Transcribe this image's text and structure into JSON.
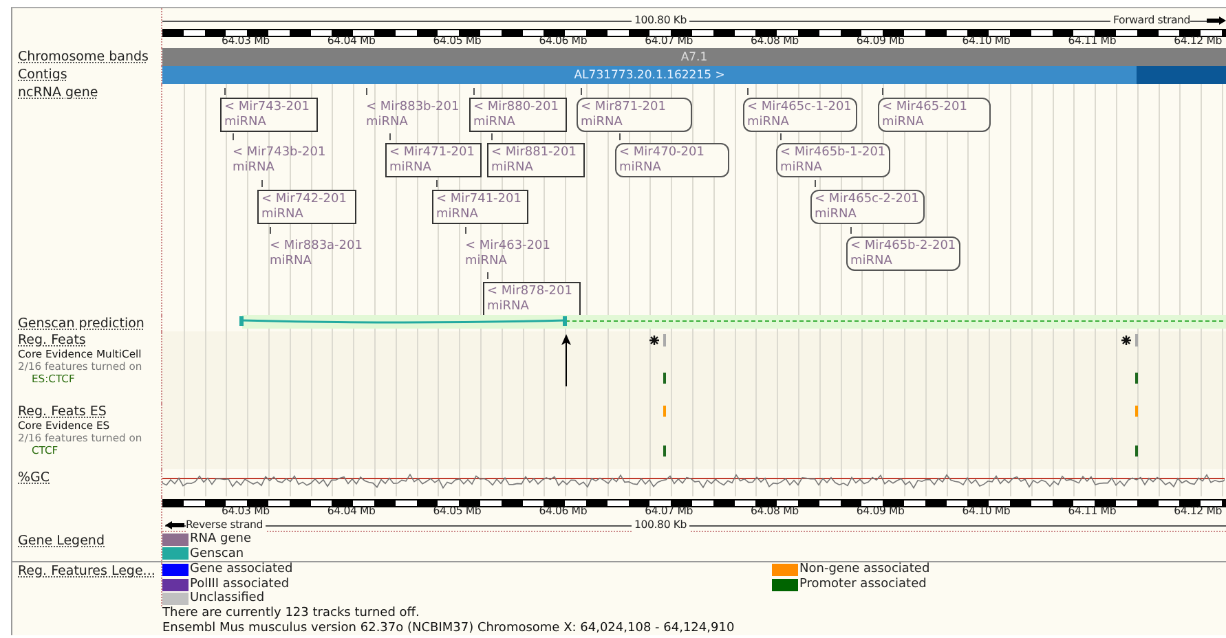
{
  "top_ruler": {
    "span": "100.80 Kb",
    "strand": "Forward strand",
    "ticks": [
      "64.03 Mb",
      "64.04 Mb",
      "64.05 Mb",
      "64.06 Mb",
      "64.07 Mb",
      "64.08 Mb",
      "64.09 Mb",
      "64.10 Mb",
      "64.11 Mb",
      "64.12 Mb"
    ]
  },
  "tracks": [
    {
      "kind": "bands",
      "label": "Chromosome bands",
      "band": "A7.1"
    },
    {
      "kind": "contigs",
      "label": "Contigs",
      "contig": "AL731773.20.1.162215 >"
    },
    {
      "kind": "genes",
      "label": "ncRNA gene",
      "genes": [
        {
          "name": "< Mir743-201",
          "biotype": "miRNA",
          "kind": "boxed"
        },
        {
          "name": "< Mir883b-201",
          "biotype": "miRNA",
          "kind": "plain"
        },
        {
          "name": "< Mir880-201",
          "biotype": "miRNA",
          "kind": "boxed"
        },
        {
          "name": "< Mir871-201",
          "biotype": "miRNA",
          "kind": "rounded"
        },
        {
          "name": "< Mir465c-1-201",
          "biotype": "miRNA",
          "kind": "rounded"
        },
        {
          "name": "< Mir465-201",
          "biotype": "miRNA",
          "kind": "rounded"
        },
        {
          "name": "< Mir743b-201",
          "biotype": "miRNA",
          "kind": "plain"
        },
        {
          "name": "< Mir471-201",
          "biotype": "miRNA",
          "kind": "boxed"
        },
        {
          "name": "< Mir881-201",
          "biotype": "miRNA",
          "kind": "boxed"
        },
        {
          "name": "< Mir470-201",
          "biotype": "miRNA",
          "kind": "rounded"
        },
        {
          "name": "< Mir465b-1-201",
          "biotype": "miRNA",
          "kind": "rounded"
        },
        {
          "name": "< Mir742-201",
          "biotype": "miRNA",
          "kind": "boxed"
        },
        {
          "name": "< Mir741-201",
          "biotype": "miRNA",
          "kind": "boxed"
        },
        {
          "name": "< Mir465c-2-201",
          "biotype": "miRNA",
          "kind": "rounded"
        },
        {
          "name": "< Mir883a-201",
          "biotype": "miRNA",
          "kind": "plain"
        },
        {
          "name": "< Mir463-201",
          "biotype": "miRNA",
          "kind": "plain"
        },
        {
          "name": "< Mir465b-2-201",
          "biotype": "miRNA",
          "kind": "rounded"
        },
        {
          "name": "< Mir878-201",
          "biotype": "miRNA",
          "kind": "boxed"
        }
      ]
    },
    {
      "kind": "genscan",
      "label": "Genscan prediction"
    },
    {
      "kind": "regfeats",
      "label": "Reg. Feats",
      "subtitle": "Core Evidence MultiCell",
      "note": "2/16 features turned on",
      "cell": "ES:CTCF"
    },
    {
      "kind": "regfeats",
      "label": "Reg. Feats ES",
      "subtitle": "Core Evidence ES",
      "note": "2/16 features turned on",
      "cell": "CTCF"
    },
    {
      "kind": "gc",
      "label": "%GC"
    }
  ],
  "bottom_ruler": {
    "ticks": [
      "64.03 Mb",
      "64.04 Mb",
      "64.05 Mb",
      "64.06 Mb",
      "64.07 Mb",
      "64.08 Mb",
      "64.09 Mb",
      "64.10 Mb",
      "64.11 Mb",
      "64.12 Mb"
    ],
    "strand": "Reverse strand",
    "span": "100.80 Kb"
  },
  "legends": [
    {
      "label": "Gene Legend",
      "items": [
        {
          "label": "RNA gene",
          "color": "#8e6e8e"
        },
        {
          "label": "Genscan",
          "color": "#22aaa0"
        }
      ]
    },
    {
      "label": "Reg. Features Lege...",
      "items": [
        {
          "label": "Gene associated",
          "color": "#0000ff"
        },
        {
          "label": "Non-gene associated",
          "color": "#ff8c00"
        },
        {
          "label": "PolIII associated",
          "color": "#6633a0"
        },
        {
          "label": "Promoter associated",
          "color": "#006400"
        },
        {
          "label": "Unclassified",
          "color": "#c0c0c0"
        }
      ]
    }
  ],
  "footer": [
    "There are currently 123 tracks turned off.",
    "Ensembl Mus musculus version 62.37o (NCBIM37) Chromosome X: 64,024,108 - 64,124,910"
  ]
}
